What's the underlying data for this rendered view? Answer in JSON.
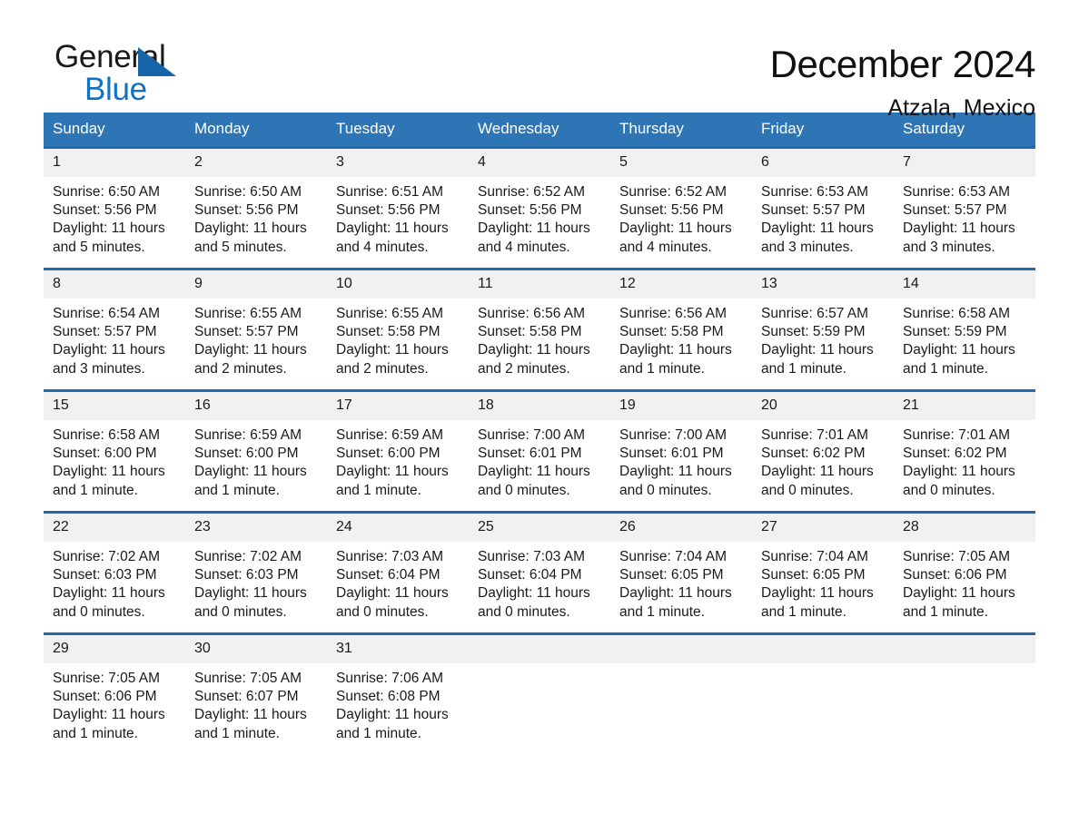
{
  "brand": {
    "name_part1": "General",
    "name_part2": "Blue",
    "triangle_color": "#1565a8",
    "blue_text_color": "#1271c1"
  },
  "header": {
    "title": "December 2024",
    "subtitle": "Atzala, Mexico"
  },
  "colors": {
    "header_bg": "#2e75b6",
    "header_text": "#ffffff",
    "week_border": "#1f6cac",
    "daynum_bg": "#f1f1f1",
    "page_bg": "#ffffff"
  },
  "weekday_headers": [
    "Sunday",
    "Monday",
    "Tuesday",
    "Wednesday",
    "Thursday",
    "Friday",
    "Saturday"
  ],
  "weeks": [
    [
      {
        "day": "1",
        "sunrise": "Sunrise: 6:50 AM",
        "sunset": "Sunset: 5:56 PM",
        "daylight_line1": "Daylight: 11 hours",
        "daylight_line2": "and 5 minutes."
      },
      {
        "day": "2",
        "sunrise": "Sunrise: 6:50 AM",
        "sunset": "Sunset: 5:56 PM",
        "daylight_line1": "Daylight: 11 hours",
        "daylight_line2": "and 5 minutes."
      },
      {
        "day": "3",
        "sunrise": "Sunrise: 6:51 AM",
        "sunset": "Sunset: 5:56 PM",
        "daylight_line1": "Daylight: 11 hours",
        "daylight_line2": "and 4 minutes."
      },
      {
        "day": "4",
        "sunrise": "Sunrise: 6:52 AM",
        "sunset": "Sunset: 5:56 PM",
        "daylight_line1": "Daylight: 11 hours",
        "daylight_line2": "and 4 minutes."
      },
      {
        "day": "5",
        "sunrise": "Sunrise: 6:52 AM",
        "sunset": "Sunset: 5:56 PM",
        "daylight_line1": "Daylight: 11 hours",
        "daylight_line2": "and 4 minutes."
      },
      {
        "day": "6",
        "sunrise": "Sunrise: 6:53 AM",
        "sunset": "Sunset: 5:57 PM",
        "daylight_line1": "Daylight: 11 hours",
        "daylight_line2": "and 3 minutes."
      },
      {
        "day": "7",
        "sunrise": "Sunrise: 6:53 AM",
        "sunset": "Sunset: 5:57 PM",
        "daylight_line1": "Daylight: 11 hours",
        "daylight_line2": "and 3 minutes."
      }
    ],
    [
      {
        "day": "8",
        "sunrise": "Sunrise: 6:54 AM",
        "sunset": "Sunset: 5:57 PM",
        "daylight_line1": "Daylight: 11 hours",
        "daylight_line2": "and 3 minutes."
      },
      {
        "day": "9",
        "sunrise": "Sunrise: 6:55 AM",
        "sunset": "Sunset: 5:57 PM",
        "daylight_line1": "Daylight: 11 hours",
        "daylight_line2": "and 2 minutes."
      },
      {
        "day": "10",
        "sunrise": "Sunrise: 6:55 AM",
        "sunset": "Sunset: 5:58 PM",
        "daylight_line1": "Daylight: 11 hours",
        "daylight_line2": "and 2 minutes."
      },
      {
        "day": "11",
        "sunrise": "Sunrise: 6:56 AM",
        "sunset": "Sunset: 5:58 PM",
        "daylight_line1": "Daylight: 11 hours",
        "daylight_line2": "and 2 minutes."
      },
      {
        "day": "12",
        "sunrise": "Sunrise: 6:56 AM",
        "sunset": "Sunset: 5:58 PM",
        "daylight_line1": "Daylight: 11 hours",
        "daylight_line2": "and 1 minute."
      },
      {
        "day": "13",
        "sunrise": "Sunrise: 6:57 AM",
        "sunset": "Sunset: 5:59 PM",
        "daylight_line1": "Daylight: 11 hours",
        "daylight_line2": "and 1 minute."
      },
      {
        "day": "14",
        "sunrise": "Sunrise: 6:58 AM",
        "sunset": "Sunset: 5:59 PM",
        "daylight_line1": "Daylight: 11 hours",
        "daylight_line2": "and 1 minute."
      }
    ],
    [
      {
        "day": "15",
        "sunrise": "Sunrise: 6:58 AM",
        "sunset": "Sunset: 6:00 PM",
        "daylight_line1": "Daylight: 11 hours",
        "daylight_line2": "and 1 minute."
      },
      {
        "day": "16",
        "sunrise": "Sunrise: 6:59 AM",
        "sunset": "Sunset: 6:00 PM",
        "daylight_line1": "Daylight: 11 hours",
        "daylight_line2": "and 1 minute."
      },
      {
        "day": "17",
        "sunrise": "Sunrise: 6:59 AM",
        "sunset": "Sunset: 6:00 PM",
        "daylight_line1": "Daylight: 11 hours",
        "daylight_line2": "and 1 minute."
      },
      {
        "day": "18",
        "sunrise": "Sunrise: 7:00 AM",
        "sunset": "Sunset: 6:01 PM",
        "daylight_line1": "Daylight: 11 hours",
        "daylight_line2": "and 0 minutes."
      },
      {
        "day": "19",
        "sunrise": "Sunrise: 7:00 AM",
        "sunset": "Sunset: 6:01 PM",
        "daylight_line1": "Daylight: 11 hours",
        "daylight_line2": "and 0 minutes."
      },
      {
        "day": "20",
        "sunrise": "Sunrise: 7:01 AM",
        "sunset": "Sunset: 6:02 PM",
        "daylight_line1": "Daylight: 11 hours",
        "daylight_line2": "and 0 minutes."
      },
      {
        "day": "21",
        "sunrise": "Sunrise: 7:01 AM",
        "sunset": "Sunset: 6:02 PM",
        "daylight_line1": "Daylight: 11 hours",
        "daylight_line2": "and 0 minutes."
      }
    ],
    [
      {
        "day": "22",
        "sunrise": "Sunrise: 7:02 AM",
        "sunset": "Sunset: 6:03 PM",
        "daylight_line1": "Daylight: 11 hours",
        "daylight_line2": "and 0 minutes."
      },
      {
        "day": "23",
        "sunrise": "Sunrise: 7:02 AM",
        "sunset": "Sunset: 6:03 PM",
        "daylight_line1": "Daylight: 11 hours",
        "daylight_line2": "and 0 minutes."
      },
      {
        "day": "24",
        "sunrise": "Sunrise: 7:03 AM",
        "sunset": "Sunset: 6:04 PM",
        "daylight_line1": "Daylight: 11 hours",
        "daylight_line2": "and 0 minutes."
      },
      {
        "day": "25",
        "sunrise": "Sunrise: 7:03 AM",
        "sunset": "Sunset: 6:04 PM",
        "daylight_line1": "Daylight: 11 hours",
        "daylight_line2": "and 0 minutes."
      },
      {
        "day": "26",
        "sunrise": "Sunrise: 7:04 AM",
        "sunset": "Sunset: 6:05 PM",
        "daylight_line1": "Daylight: 11 hours",
        "daylight_line2": "and 1 minute."
      },
      {
        "day": "27",
        "sunrise": "Sunrise: 7:04 AM",
        "sunset": "Sunset: 6:05 PM",
        "daylight_line1": "Daylight: 11 hours",
        "daylight_line2": "and 1 minute."
      },
      {
        "day": "28",
        "sunrise": "Sunrise: 7:05 AM",
        "sunset": "Sunset: 6:06 PM",
        "daylight_line1": "Daylight: 11 hours",
        "daylight_line2": "and 1 minute."
      }
    ],
    [
      {
        "day": "29",
        "sunrise": "Sunrise: 7:05 AM",
        "sunset": "Sunset: 6:06 PM",
        "daylight_line1": "Daylight: 11 hours",
        "daylight_line2": "and 1 minute."
      },
      {
        "day": "30",
        "sunrise": "Sunrise: 7:05 AM",
        "sunset": "Sunset: 6:07 PM",
        "daylight_line1": "Daylight: 11 hours",
        "daylight_line2": "and 1 minute."
      },
      {
        "day": "31",
        "sunrise": "Sunrise: 7:06 AM",
        "sunset": "Sunset: 6:08 PM",
        "daylight_line1": "Daylight: 11 hours",
        "daylight_line2": "and 1 minute."
      },
      {
        "day": "",
        "sunrise": "",
        "sunset": "",
        "daylight_line1": "",
        "daylight_line2": ""
      },
      {
        "day": "",
        "sunrise": "",
        "sunset": "",
        "daylight_line1": "",
        "daylight_line2": ""
      },
      {
        "day": "",
        "sunrise": "",
        "sunset": "",
        "daylight_line1": "",
        "daylight_line2": ""
      },
      {
        "day": "",
        "sunrise": "",
        "sunset": "",
        "daylight_line1": "",
        "daylight_line2": ""
      }
    ]
  ]
}
